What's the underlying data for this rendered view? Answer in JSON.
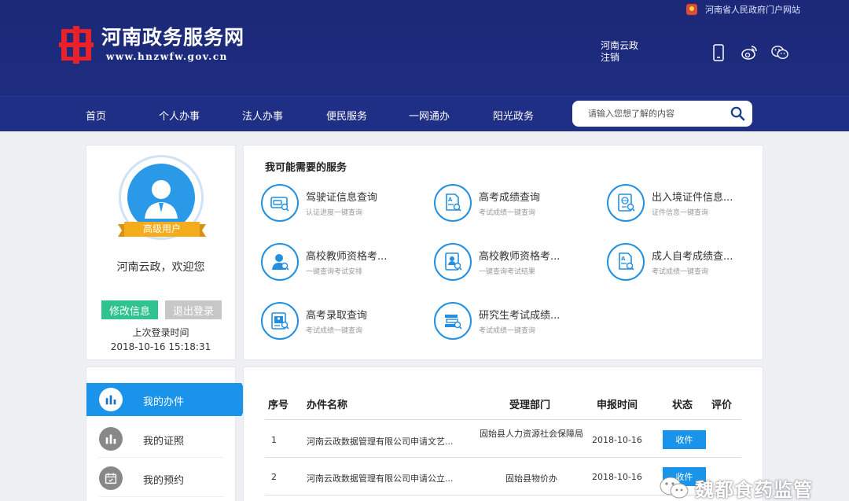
{
  "header": {
    "gov_link": "河南省人民政府门户网站",
    "logo_title": "河南政务服务网",
    "logo_url": "www.hnzwfw.gov.cn",
    "username": "河南云政",
    "logout": "注销",
    "icons": [
      "mobile-icon",
      "weibo-icon",
      "wechat-icon"
    ]
  },
  "nav": {
    "items": [
      "首页",
      "个人办事",
      "法人办事",
      "便民服务",
      "一网通办",
      "阳光政务"
    ],
    "search_placeholder": "请输入您想了解的内容"
  },
  "profile": {
    "badge": "高级用户",
    "welcome": "河南云政，欢迎您",
    "edit_button": "修改信息",
    "logout_button": "退出登录",
    "last_login_label": "上次登录时间",
    "last_login_time": "2018-10-16 15:18:31"
  },
  "services": {
    "title": "我可能需要的服务",
    "items": [
      {
        "name": "驾驶证信息查询",
        "desc": "认证进度一键查询",
        "icon": "license-icon"
      },
      {
        "name": "高考成绩查询",
        "desc": "考试成绩一键查询",
        "icon": "score-doc-icon"
      },
      {
        "name": "出入境证件信息...",
        "desc": "证件信息一键查询",
        "icon": "passport-icon"
      },
      {
        "name": "高校教师资格考...",
        "desc": "一键查询考试安排",
        "icon": "teacher-icon"
      },
      {
        "name": "高校教师资格考...",
        "desc": "一键查询考试结果",
        "icon": "teacher-result-icon"
      },
      {
        "name": "成人自考成绩查...",
        "desc": "考试成绩一键查询",
        "icon": "adult-exam-icon"
      },
      {
        "name": "高考录取查询",
        "desc": "考试成绩一键查询",
        "icon": "admission-icon"
      },
      {
        "name": "研究生考试成绩...",
        "desc": "考试成绩一键查询",
        "icon": "graduate-icon"
      }
    ]
  },
  "menu": {
    "items": [
      {
        "label": "我的办件",
        "icon": "bar-chart-icon"
      },
      {
        "label": "我的证照",
        "icon": "bar-chart-icon"
      },
      {
        "label": "我的预约",
        "icon": "calendar-icon"
      }
    ]
  },
  "table": {
    "headers": [
      "序号",
      "办件名称",
      "受理部门",
      "申报时间",
      "状态",
      "评价"
    ],
    "rows": [
      {
        "no": "1",
        "name": "河南云政数据管理有限公司申请文艺...",
        "dept": "固始县人力资源社会保障局",
        "date": "2018-10-16",
        "status": "收件",
        "rating": ""
      },
      {
        "no": "2",
        "name": "河南云政数据管理有限公司申请公立...",
        "dept": "固始县物价办",
        "date": "2018-10-16",
        "status": "收件",
        "rating": ""
      }
    ]
  },
  "watermark": {
    "text": "魏都食药监管"
  }
}
